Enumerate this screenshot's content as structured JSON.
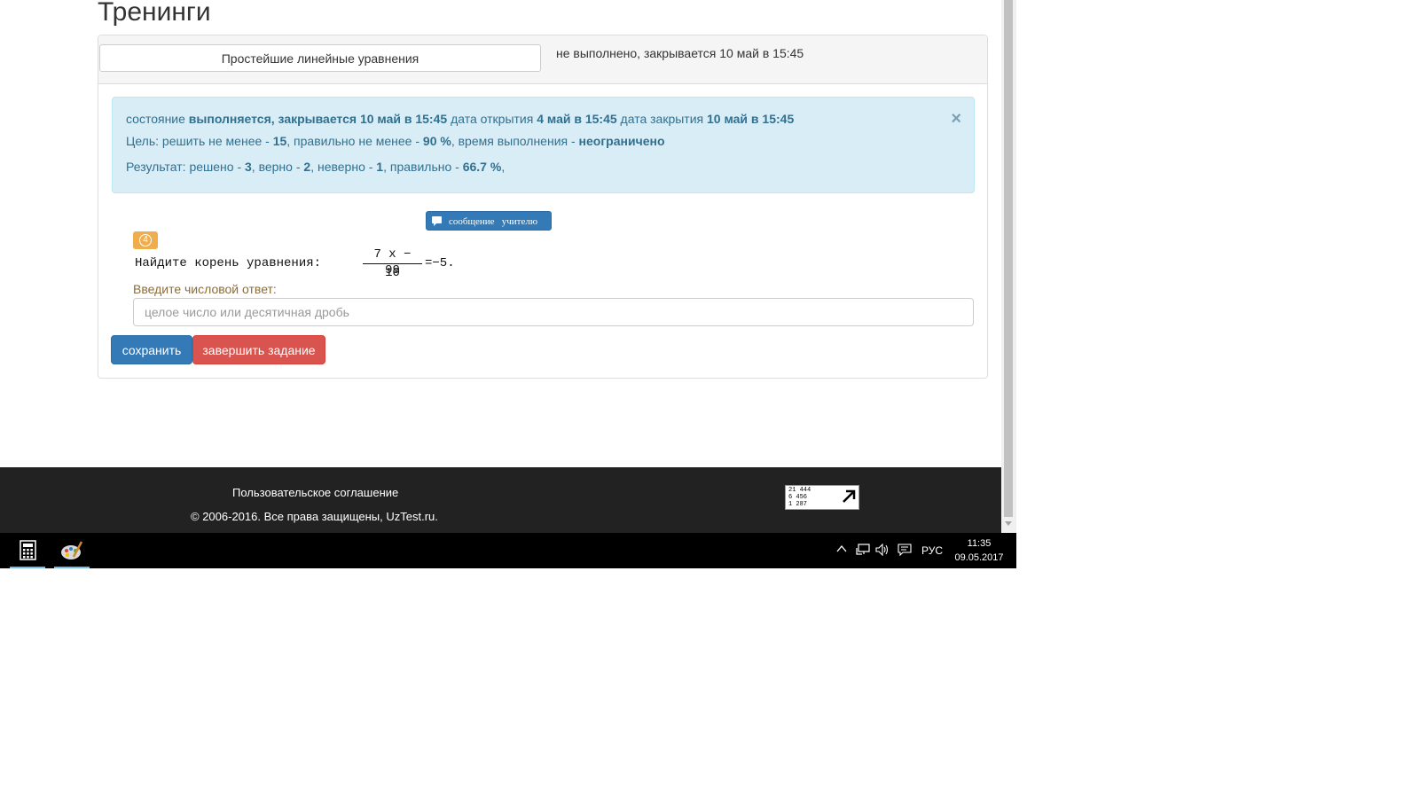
{
  "page": {
    "title": "Тренинги"
  },
  "training": {
    "topic_button": "Простейшие линейные уравнения",
    "status": "не выполнено, закрывается 10 май в 15:45"
  },
  "info": {
    "state_label": "состояние",
    "state_value": "выполняется, закрывается 10 май в 15:45",
    "open_label": "дата открытия",
    "open_value": "4 май в 15:45",
    "close_label": "дата закрытия",
    "close_value": "10 май в 15:45",
    "goal_label": "Цель: решить не менее - ",
    "goal_solve": "15",
    "goal_correct_label": ", правильно не менее - ",
    "goal_correct": "90 %",
    "goal_time_label": ", время выполнения - ",
    "goal_time": "неограничено",
    "result_label": "Результат: решено - ",
    "result_solved": "3",
    "result_right_label": ", верно - ",
    "result_right": "2",
    "result_wrong_label": ", неверно - ",
    "result_wrong": "1",
    "result_pct_label": ", правильно - ",
    "result_pct": "66.7 %",
    "result_tail": ",",
    "close_symbol": "×"
  },
  "message_button": "сообщение   учителю",
  "task": {
    "number": "4",
    "question_prefix": "Найдите корень уравнения:",
    "numerator": "7 x − 99",
    "denominator": "10",
    "question_suffix": "=−5.",
    "answer_label": "Введите числовой ответ:",
    "answer_placeholder": "целое число или десятичная дробь",
    "answer_value": ""
  },
  "buttons": {
    "save": "сохранить",
    "finish": "завершить задание"
  },
  "footer": {
    "agreement": "Пользовательское соглашение",
    "copyright": "© 2006-2016. Все права защищены, UzTest.ru.",
    "counter_lines": [
      "21 444",
      "6 456",
      "1 287"
    ]
  },
  "taskbar": {
    "language": "РУС",
    "time": "11:35",
    "date": "09.05.2017"
  },
  "colors": {
    "primary": "#337ab7",
    "danger": "#d9534f",
    "info_bg": "#d9edf7",
    "warning": "#f0ad4e",
    "footer_bg": "#222222"
  }
}
